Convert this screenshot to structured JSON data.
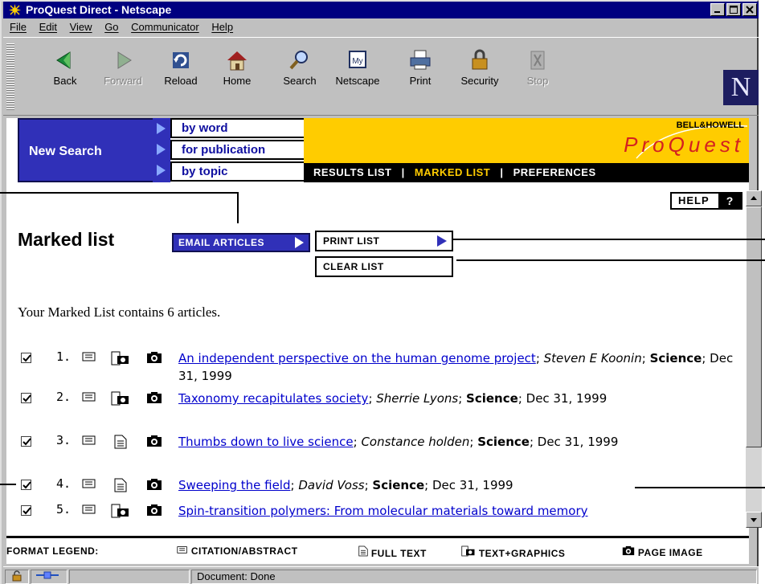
{
  "window": {
    "title": "ProQuest Direct - Netscape"
  },
  "menu": [
    "File",
    "Edit",
    "View",
    "Go",
    "Communicator",
    "Help"
  ],
  "toolbar": {
    "buttons": [
      {
        "label": "Back",
        "icon": "back-arrow-icon",
        "enabled": true
      },
      {
        "label": "Forward",
        "icon": "forward-arrow-icon",
        "enabled": false
      },
      {
        "label": "Reload",
        "icon": "reload-icon",
        "enabled": true
      },
      {
        "label": "Home",
        "icon": "home-icon",
        "enabled": true
      },
      {
        "label": "Search",
        "icon": "search-icon",
        "enabled": true
      },
      {
        "label": "Netscape",
        "icon": "my-netscape-icon",
        "enabled": true
      },
      {
        "label": "Print",
        "icon": "printer-icon",
        "enabled": true
      },
      {
        "label": "Security",
        "icon": "padlock-icon",
        "enabled": true
      },
      {
        "label": "Stop",
        "icon": "stop-icon",
        "enabled": false
      }
    ],
    "logo_letter": "N"
  },
  "banner": {
    "new_search": "New Search",
    "options": [
      "by word",
      "for publication",
      "by topic"
    ],
    "brand_small": "BELL&HOWELL",
    "brand": "ProQuest",
    "nav": [
      {
        "label": "RESULTS LIST",
        "active": false
      },
      {
        "label": "MARKED LIST",
        "active": true
      },
      {
        "label": "PREFERENCES",
        "active": false
      }
    ],
    "nav_separator": "|"
  },
  "help": {
    "label": "HELP",
    "icon_glyph": "?"
  },
  "page": {
    "title": "Marked list",
    "email_button": "EMAIL ARTICLES",
    "print_button": "PRINT LIST",
    "clear_button": "CLEAR LIST",
    "count_text": "Your Marked List contains 6 articles."
  },
  "articles": [
    {
      "num": "1.",
      "checked": true,
      "format": "text-graphics",
      "title": "An independent perspective on the human genome project",
      "author": "Steven E Koonin",
      "publication": "Science",
      "date": "Dec 31, 1999"
    },
    {
      "num": "2.",
      "checked": true,
      "format": "text-graphics",
      "title": "Taxonomy recapitulates society",
      "author": "Sherrie Lyons",
      "publication": "Science",
      "date": "Dec 31, 1999"
    },
    {
      "num": "3.",
      "checked": true,
      "format": "full-text",
      "title": "Thumbs down to live science",
      "author": "Constance holden",
      "publication": "Science",
      "date": "Dec 31, 1999"
    },
    {
      "num": "4.",
      "checked": true,
      "format": "full-text",
      "title": "Sweeping the field",
      "author": "David Voss",
      "publication": "Science",
      "date": "Dec 31, 1999"
    },
    {
      "num": "5.",
      "checked": true,
      "format": "text-graphics",
      "title": "Spin-transition polymers: From molecular materials toward memory",
      "author": "",
      "publication": "",
      "date": ""
    }
  ],
  "legend": {
    "heading": "FORMAT LEGEND:",
    "items": [
      "CITATION/ABSTRACT",
      "FULL TEXT",
      "TEXT+GRAPHICS",
      "PAGE IMAGE"
    ]
  },
  "status": {
    "text": "Document: Done"
  },
  "colors": {
    "title_bar": "#000080",
    "banner_blue": "#3030b8",
    "banner_yellow": "#ffcc00",
    "brand_red": "#d42020",
    "link": "#0000cc"
  }
}
